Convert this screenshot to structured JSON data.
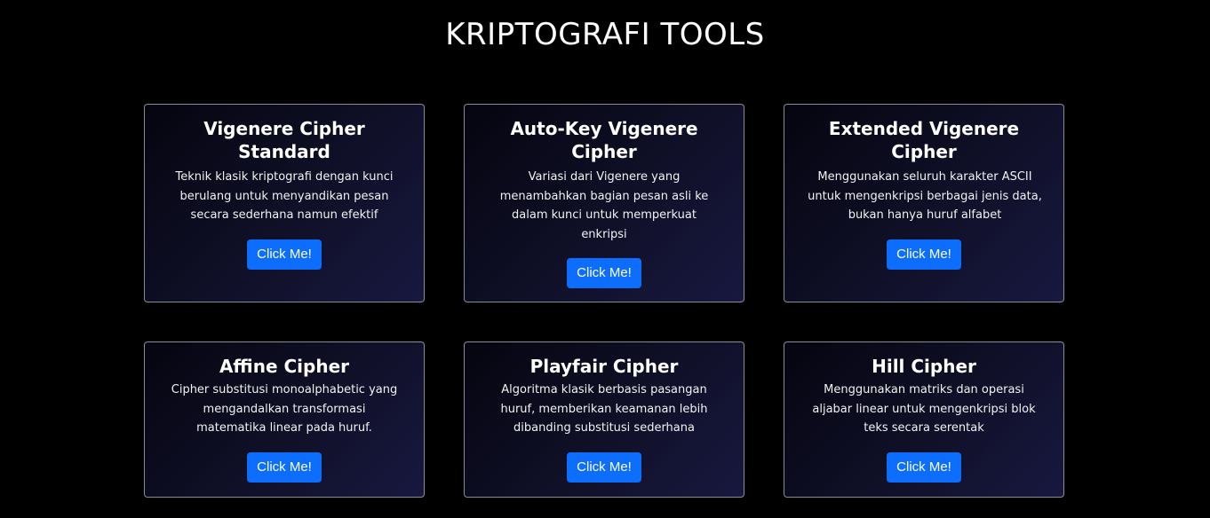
{
  "page": {
    "title": "KRIPTOGRAFI TOOLS"
  },
  "cards": [
    {
      "title": "Vigenere Cipher Standard",
      "description": "Teknik klasik kriptografi dengan kunci berulang untuk menyandikan pesan secara sederhana namun efektif",
      "button_label": "Click Me!"
    },
    {
      "title": "Auto-Key Vigenere Cipher",
      "description": "Variasi dari Vigenere yang menambahkan bagian pesan asli ke dalam kunci untuk memperkuat enkripsi",
      "button_label": "Click Me!"
    },
    {
      "title": "Extended Vigenere Cipher",
      "description": "Menggunakan seluruh karakter ASCII untuk mengenkripsi berbagai jenis data, bukan hanya huruf alfabet",
      "button_label": "Click Me!"
    },
    {
      "title": "Affine Cipher",
      "description": "Cipher substitusi monoalphabetic yang mengandalkan transformasi matematika linear pada huruf.",
      "button_label": "Click Me!"
    },
    {
      "title": "Playfair Cipher",
      "description": "Algoritma klasik berbasis pasangan huruf, memberikan keamanan lebih dibanding substitusi sederhana",
      "button_label": "Click Me!"
    },
    {
      "title": "Hill Cipher",
      "description": "Menggunakan matriks dan operasi aljabar linear untuk mengenkripsi blok teks secara serentak",
      "button_label": "Click Me!"
    }
  ],
  "colors": {
    "background": "#000000",
    "button": "#0d6efd",
    "card_border": "#8a8a99"
  }
}
